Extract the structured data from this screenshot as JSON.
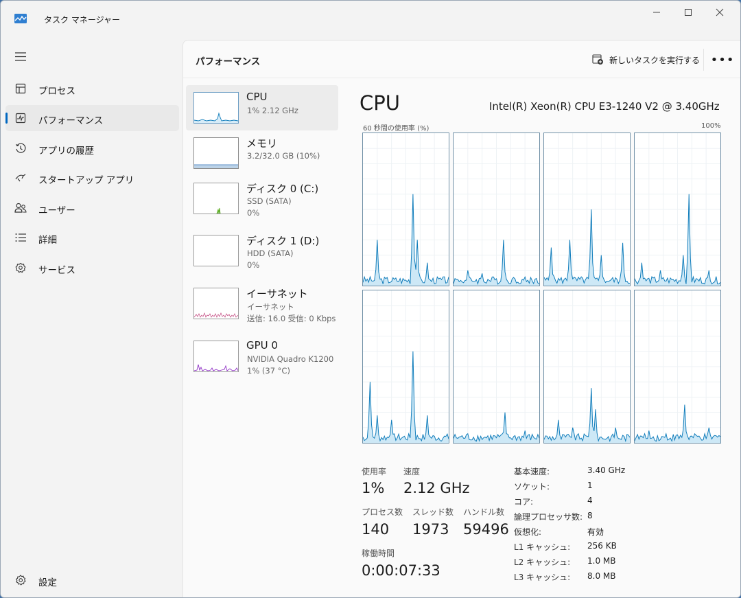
{
  "window": {
    "title": "タスク マネージャー"
  },
  "nav": {
    "items": [
      {
        "label": "プロセス",
        "icon": "processes-icon"
      },
      {
        "label": "パフォーマンス",
        "icon": "performance-icon",
        "active": true
      },
      {
        "label": "アプリの履歴",
        "icon": "app-history-icon"
      },
      {
        "label": "スタートアップ アプリ",
        "icon": "startup-apps-icon"
      },
      {
        "label": "ユーザー",
        "icon": "users-icon"
      },
      {
        "label": "詳細",
        "icon": "details-icon"
      },
      {
        "label": "サービス",
        "icon": "services-icon"
      }
    ],
    "settings_label": "設定"
  },
  "header": {
    "title": "パフォーマンス",
    "run_task_label": "新しいタスクを実行する",
    "more_label": "•••"
  },
  "resources": [
    {
      "name": "CPU",
      "sub1": "1%  2.12 GHz",
      "sub2": "",
      "color": "#117dbb"
    },
    {
      "name": "メモリ",
      "sub1": "3.2/32.0 GB (10%)",
      "sub2": "",
      "color": "#8b12ae"
    },
    {
      "name": "ディスク 0 (C:)",
      "sub1": "SSD (SATA)",
      "sub2": "0%",
      "color": "#4da60c"
    },
    {
      "name": "ディスク 1 (D:)",
      "sub1": "HDD (SATA)",
      "sub2": "0%",
      "color": "#4da60c"
    },
    {
      "name": "イーサネット",
      "sub1": "イーサネット",
      "sub2": "送信: 16.0  受信: 0 Kbps",
      "color": "#a74f01"
    },
    {
      "name": "GPU 0",
      "sub1": "NVIDIA Quadro K1200",
      "sub2": "1%  (37 °C)",
      "color": "#8e2ec4"
    }
  ],
  "detail": {
    "title": "CPU",
    "model": "Intel(R) Xeon(R) CPU E3-1240 V2 @ 3.40GHz",
    "graph_label": "60 秒間の使用率 (%)",
    "graph_max": "100%",
    "stats": {
      "usage_label": "使用率",
      "usage_value": "1%",
      "speed_label": "速度",
      "speed_value": "2.12 GHz",
      "processes_label": "プロセス数",
      "processes_value": "140",
      "threads_label": "スレッド数",
      "threads_value": "1973",
      "handles_label": "ハンドル数",
      "handles_value": "59496",
      "uptime_label": "稼働時間",
      "uptime_value": "0:00:07:33"
    },
    "info": [
      {
        "key": "基本速度:",
        "value": "3.40 GHz"
      },
      {
        "key": "ソケット:",
        "value": "1"
      },
      {
        "key": "コア:",
        "value": "4"
      },
      {
        "key": "論理プロセッサ数:",
        "value": "8"
      },
      {
        "key": "仮想化:",
        "value": "有効"
      },
      {
        "key": "L1 キャッシュ:",
        "value": "256 KB"
      },
      {
        "key": "L2 キャッシュ:",
        "value": "1.0 MB"
      },
      {
        "key": "L3 キャッシュ:",
        "value": "8.0 MB"
      }
    ]
  },
  "colors": {
    "cpu_line": "#117dbb",
    "cpu_fill": "#cde8f6",
    "accent": "#0067c0"
  }
}
